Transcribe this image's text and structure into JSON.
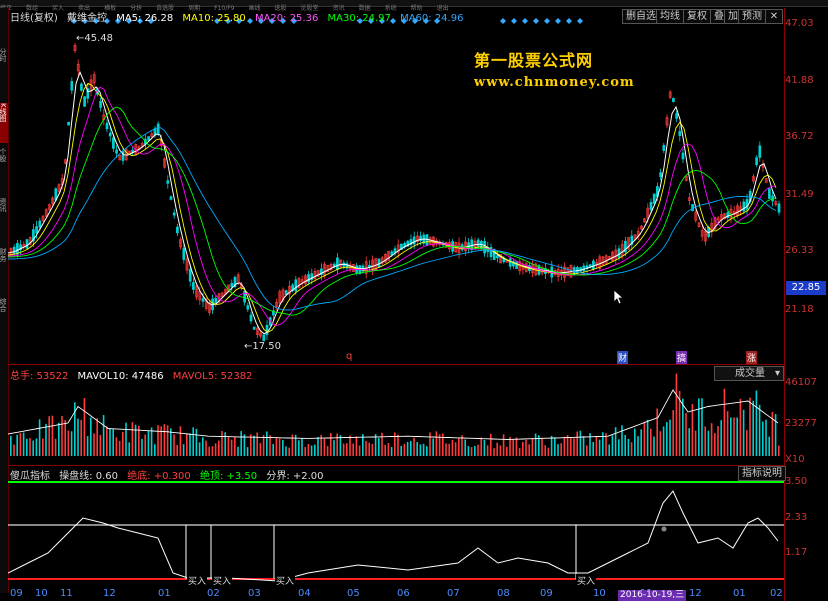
{
  "window": {
    "top_menu": [
      "修正",
      "数组",
      "买入",
      "卖出",
      "横板",
      "分析",
      "自选股",
      "周期",
      "F10/F9",
      "画线",
      "选股",
      "论股堂",
      "资讯",
      "数据",
      "系统",
      "帮助",
      "退出"
    ],
    "toolbar": {
      "add_fav": "删自选",
      "ma_line": "均线",
      "restore": "复权",
      "overlay": "叠",
      "zoom": "加",
      "forecast": "预测"
    },
    "side_tabs": [
      "分时",
      "K线图",
      "个股",
      "资讯",
      "财务",
      "综合"
    ]
  },
  "price_panel": {
    "legend": {
      "period": "日线(复权)",
      "name": "戴维金控",
      "ma5": "MA5: 26.28",
      "ma10": "MA10: 25.80",
      "ma20": "MA20: 25.36",
      "ma30": "MA30: 24.97",
      "ma60": "MA60: 24.96"
    },
    "y_ticks": [
      "47.03",
      "41.88",
      "36.72",
      "31.49",
      "26.33",
      "21.18"
    ],
    "current_price": "22.85",
    "high_label": "45.48",
    "low_label": "17.50",
    "markers": {
      "q": "q",
      "cai": "财",
      "gao": "搞",
      "zhang": "涨"
    },
    "colors": {
      "ma5": "#ffffff",
      "ma10": "#ffff00",
      "ma20": "#ff00ff",
      "ma30": "#00ff00",
      "ma60": "#00aaff",
      "up": "#ff3b3b",
      "down": "#00d0d0"
    }
  },
  "volume_panel": {
    "legend": {
      "total": "总手: 53522",
      "mavol10": "MAVOL10: 47486",
      "mavol5": "MAVOL5: 52382"
    },
    "y_ticks": [
      "46107",
      "23277",
      "X10"
    ],
    "selector": "成交量"
  },
  "indicator_panel": {
    "legend": {
      "name": "傻瓜指标",
      "pan": "操盘线: 0.60",
      "jd": "绝底: +0.300",
      "jt": "绝顶: +3.50",
      "fj": "分界: +2.00"
    },
    "y_ticks": [
      "3.50",
      "2.33",
      "1.17"
    ],
    "button": "指标说明",
    "buy_label": "买入"
  },
  "x_axis": {
    "ticks": [
      "09",
      "10",
      "11",
      "12",
      "01",
      "02",
      "03",
      "04",
      "05",
      "06",
      "07",
      "08",
      "09",
      "10",
      "11",
      "12",
      "01",
      "02"
    ],
    "date_flag": "2016-10-19,三"
  },
  "watermark": {
    "line1": "第一股票公式网",
    "line2": "www.chnmoney.com"
  }
}
